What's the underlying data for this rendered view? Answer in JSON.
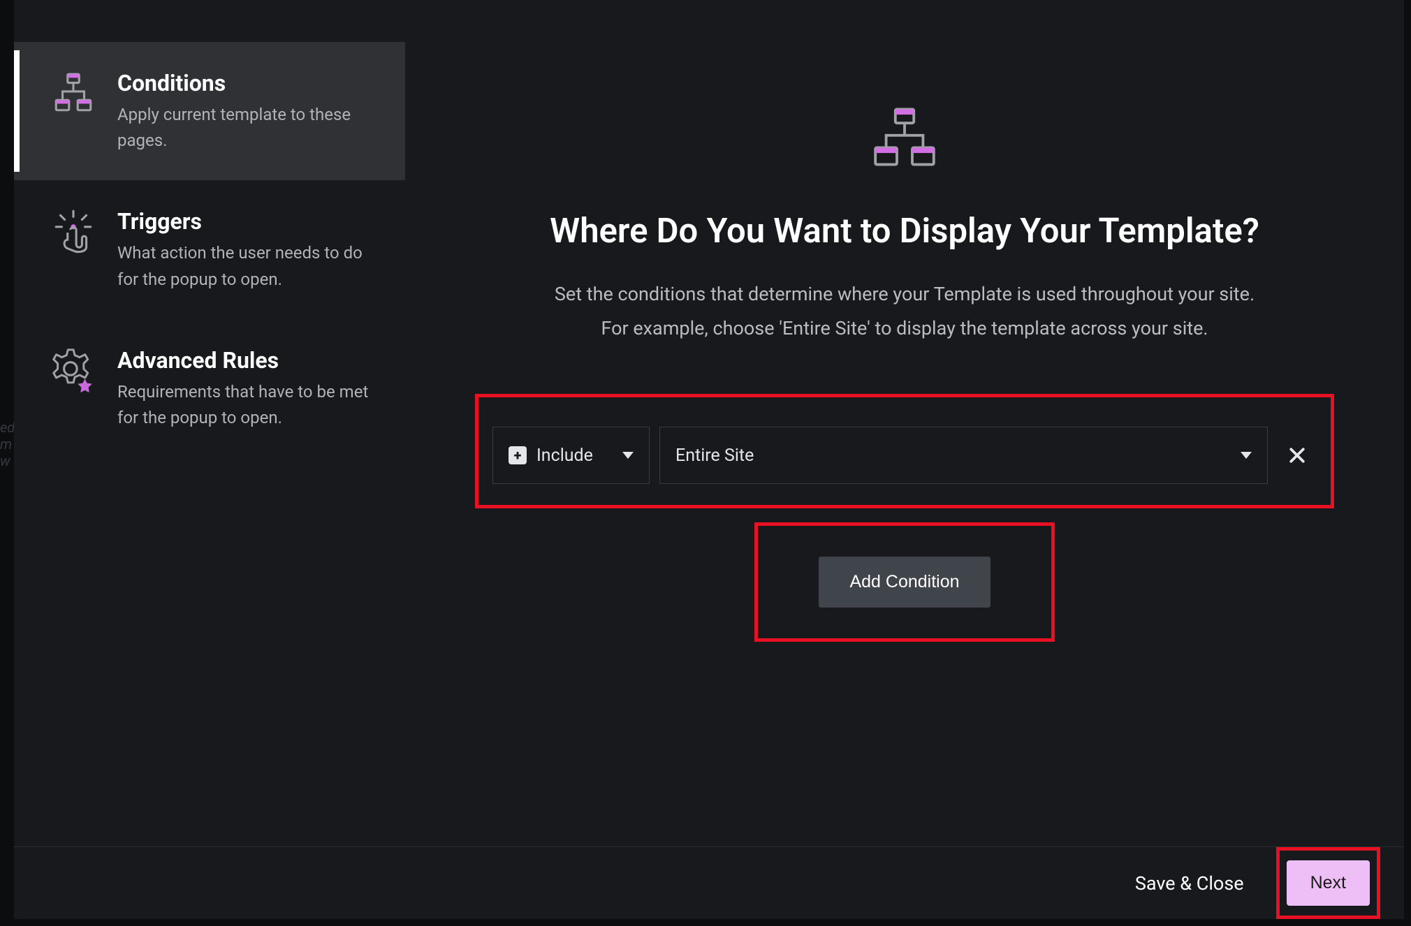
{
  "sidebar": {
    "items": [
      {
        "title": "Conditions",
        "desc": "Apply current template to these pages."
      },
      {
        "title": "Triggers",
        "desc": "What action the user needs to do for the popup to open."
      },
      {
        "title": "Advanced Rules",
        "desc": "Requirements that have to be met for the popup to open."
      }
    ]
  },
  "main": {
    "title": "Where Do You Want to Display Your Template?",
    "desc_line1": "Set the conditions that determine where your Template is used throughout your site.",
    "desc_line2": "For example, choose 'Entire Site' to display the template across your site.",
    "condition": {
      "mode": "Include",
      "location": "Entire Site"
    },
    "add_condition_label": "Add Condition"
  },
  "footer": {
    "save_close": "Save & Close",
    "next": "Next"
  },
  "highlight": {
    "condition_row": true,
    "add_condition": true,
    "next_button": true
  },
  "colors": {
    "accent": "#d98fe6",
    "highlight": "#e81123",
    "bg": "#17191c"
  }
}
